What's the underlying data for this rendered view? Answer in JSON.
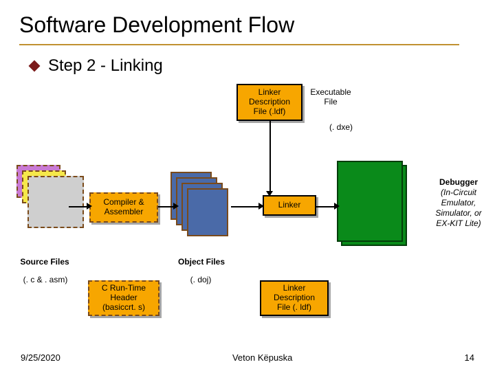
{
  "title": "Software Development Flow",
  "bullet": "Step 2 - Linking",
  "boxes": {
    "ldf_top": {
      "l1": "Linker",
      "l2": "Description",
      "l3": "File (.ldf)"
    },
    "exe_label": {
      "l1": "Executable",
      "l2": "File"
    },
    "exe_ext": "(. dxe)",
    "compiler": {
      "l1": "Compiler &",
      "l2": "Assembler"
    },
    "linker": "Linker",
    "crt": {
      "l1": "C Run-Time",
      "l2": "Header",
      "l3": "(basiccrt. s)"
    },
    "ldf_bottom": {
      "l1": "Linker",
      "l2": "Description",
      "l3": "File (. ldf)"
    }
  },
  "captions": {
    "source_files": "Source Files",
    "source_ext": "(. c & . asm)",
    "object_files": "Object Files",
    "object_ext": "(. doj)"
  },
  "debugger": {
    "heading": "Debugger",
    "sub": "(In-Circuit Emulator, Simulator, or EX-KIT Lite)"
  },
  "footer": {
    "date": "9/25/2020",
    "author": "Veton Këpuska",
    "page": "14"
  }
}
